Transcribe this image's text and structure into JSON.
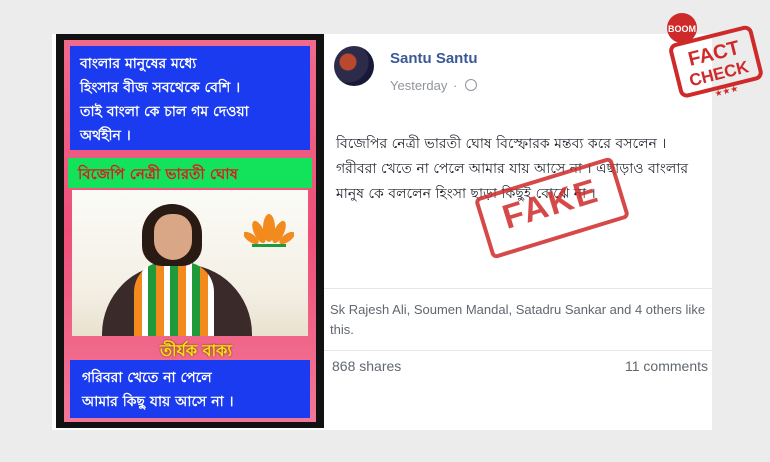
{
  "meme": {
    "box1_lines": [
      "বাংলার মানুষের মধ্যে",
      "হিংসার বীজ সবথেকে বেশি ।",
      "তাই বাংলা কে চাল গম দেওয়া",
      "অর্থহীন ।"
    ],
    "green_banner": "বিজেপি নেত্রী ভারতী ঘোষ",
    "yellow_caption": "তীর্যক বাক্য",
    "box2_lines": [
      "গরিবরা খেতে না পেলে",
      "আমার কিছু যায় আসে না ।"
    ]
  },
  "post": {
    "author": "Santu Santu",
    "timestamp": "Yesterday",
    "visibility_icon": "globe-icon",
    "body": "বিজেপির নেত্রী ভারতী ঘোষ বিস্ফোরক মন্তব্য করে বসলেন । গরীবরা খেতে না পেলে আমার যায় আসে না । এছাড়াও বাংলার মানুষ কে বললেন হিংসা ছাড়া কিছুই বোঝে না ।",
    "likes": "Sk Rajesh Ali, Soumen Mandal, Satadru Sankar and 4 others like this.",
    "shares": "868 shares",
    "comments": "11 comments"
  },
  "stamps": {
    "fake": "FAKE",
    "fact_check_top": "BOOM",
    "fact_check_line1": "FACT",
    "fact_check_line2": "CHECK",
    "color": "#cf2a2a"
  }
}
